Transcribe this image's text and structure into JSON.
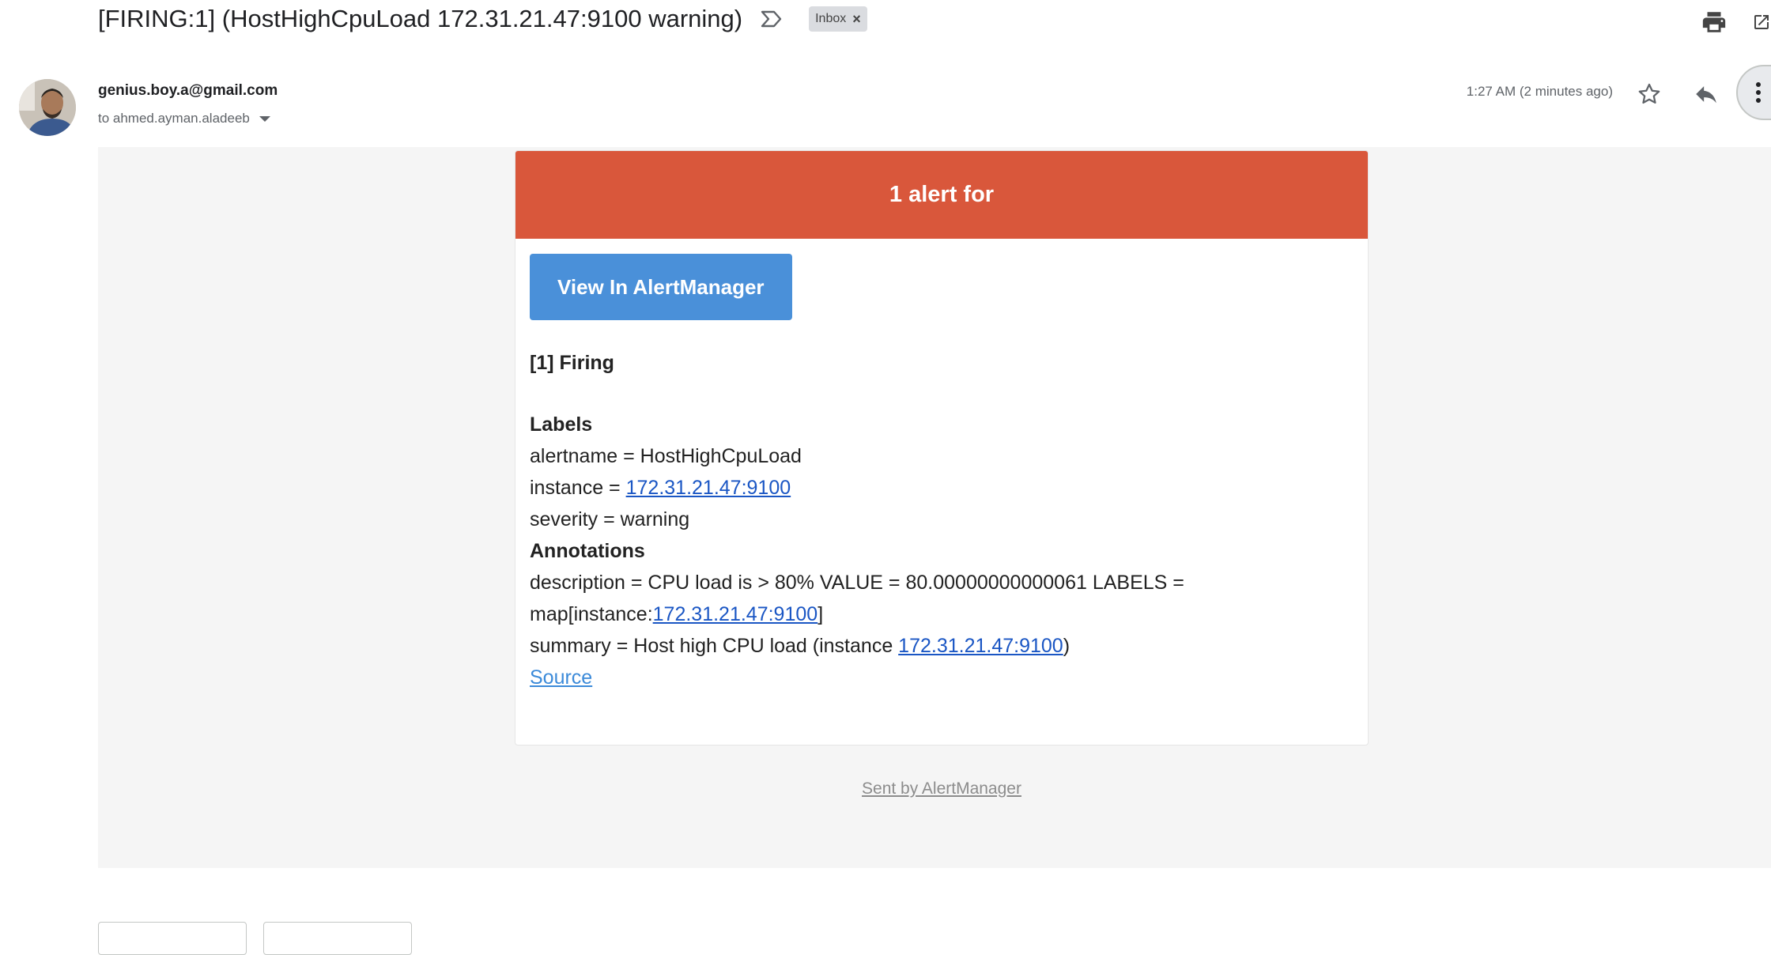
{
  "header": {
    "subject": "[FIRING:1] (HostHighCpuLoad 172.31.21.47:9100 warning)",
    "label_chip": "Inbox",
    "label_remove": "×"
  },
  "message": {
    "sender_email": "genius.boy.a@gmail.com",
    "recipient": "to ahmed.ayman.aladeeb",
    "timestamp": "1:27 AM (2 minutes ago)"
  },
  "alert": {
    "header": "1 alert for",
    "button_label": "View In AlertManager",
    "firing_title": "[1] Firing",
    "labels_title": "Labels",
    "alertname_line": "alertname = HostHighCpuLoad",
    "instance_prefix": "instance = ",
    "instance_value": "172.31.21.47:9100",
    "severity_line": "severity = warning",
    "annotations_title": "Annotations",
    "description_line1": "description = CPU load is > 80% VALUE = 80.00000000000061 LABELS =",
    "description_prefix": "map[instance:",
    "description_link": "172.31.21.47:9100",
    "description_suffix": "]",
    "summary_prefix": "summary = Host high CPU load (instance ",
    "summary_link": "172.31.21.47:9100",
    "summary_suffix": ")",
    "source_link": "Source"
  },
  "footer": {
    "sent_by": "Sent by AlertManager"
  },
  "colors": {
    "alert_header": "#d9573b",
    "button": "#4a90d9",
    "link": "#1a56c4"
  },
  "icons": [
    "important-marker-icon",
    "print-icon",
    "open-in-new-icon",
    "star-icon",
    "reply-icon",
    "more-vert-icon",
    "dropdown-arrow-icon"
  ]
}
